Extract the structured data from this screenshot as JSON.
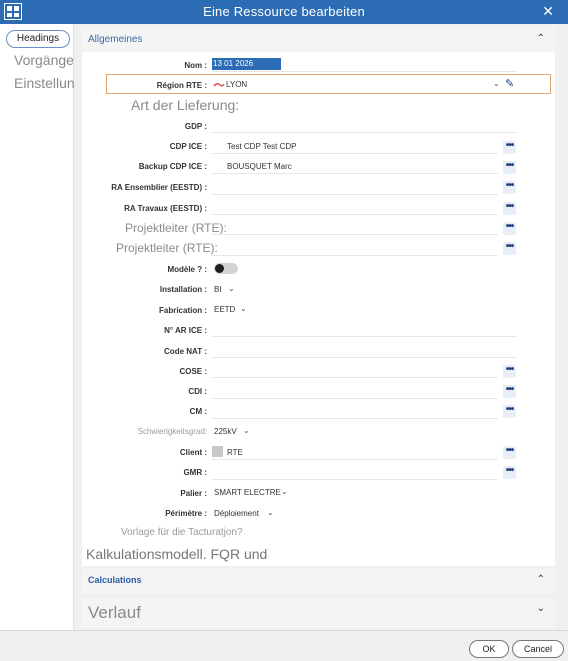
{
  "window": {
    "title": "Eine Ressource bearbeiten",
    "close_glyph": "✕",
    "app_icon": "grid-icon"
  },
  "sidebar": {
    "headings_label": "Headings",
    "items": [
      {
        "label": "Vorgänge"
      },
      {
        "label": "Einstellungen"
      }
    ]
  },
  "sections": {
    "general": {
      "label": "Allgemeines",
      "chevron": "⌃"
    },
    "calculations": {
      "label": "Calculations",
      "chevron": "⌃"
    },
    "history": {
      "label": "Verlauf",
      "chevron": "⌄"
    }
  },
  "form": {
    "name": {
      "label": "Nom :",
      "value": "13 01 2026"
    },
    "region": {
      "label": "Région RTE :",
      "value": "LYON"
    },
    "delivery_type_heading": "Art der Lieferung:",
    "gdp": {
      "label": "GDP :"
    },
    "cdp_ice": {
      "label": "CDP ICE :",
      "value": "Test CDP Test CDP"
    },
    "backup_cdp_ice": {
      "label": "Backup CDP ICE :",
      "value": "BOUSQUET Marc"
    },
    "ra_ensemblier": {
      "label": "RA Ensemblier (EESTD) :"
    },
    "ra_travaux": {
      "label": "RA Travaux (EESTD) :"
    },
    "projektleiter_1": {
      "label": "Projektleiter (RTE):"
    },
    "projektleiter_2": {
      "label": "Projektleiter (RTE):"
    },
    "modele": {
      "label": "Modèle ? :"
    },
    "installation": {
      "label": "Installation :",
      "value": "BI"
    },
    "fabrication": {
      "label": "Fabrication :",
      "value": "EETD"
    },
    "n_ar_ice": {
      "label": "N° AR ICE :"
    },
    "code_nat": {
      "label": "Code NAT :"
    },
    "cose": {
      "label": "COSE :"
    },
    "cdi": {
      "label": "CDI :"
    },
    "cm": {
      "label": "CM :"
    },
    "schwierigkeitsgrad": {
      "label": "Schwierigkeitsgrad:",
      "value": "225kV"
    },
    "client": {
      "label": "Client :",
      "value": "RTE"
    },
    "gmr": {
      "label": "GMR :"
    },
    "palier": {
      "label": "Palier :",
      "value": "SMART ELECTRE"
    },
    "perimetre": {
      "label": "Périmètre :",
      "value": "Déploiement"
    },
    "vorlage": {
      "label": "Vorlage für die Tacturatjon?"
    },
    "kalkulation": {
      "label": "Kalkulationsmodell. FQR und"
    }
  },
  "buttons": {
    "ok": "OK",
    "cancel": "Cancel"
  },
  "icons": {
    "ellipsis": "•••",
    "dropdown": "⌄",
    "pencil": "✎"
  }
}
